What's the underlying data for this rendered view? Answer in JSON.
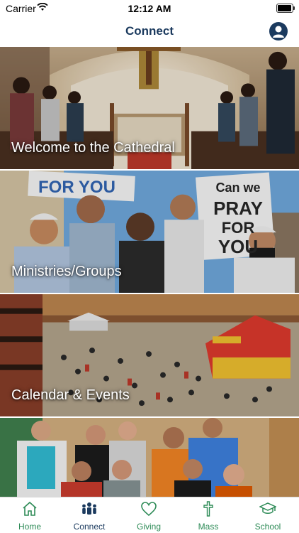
{
  "status_bar": {
    "carrier": "Carrier",
    "time": "12:12 AM"
  },
  "header": {
    "title": "Connect"
  },
  "cards": [
    {
      "label": "Welcome to the Cathedral"
    },
    {
      "label": "Ministries/Groups",
      "sign_left": "FOR YOU",
      "sign_right": "Can we PRAY FOR YOU"
    },
    {
      "label": "Calendar & Events"
    },
    {
      "label": ""
    }
  ],
  "tabs": [
    {
      "label": "Home",
      "icon": "home-icon",
      "active": false
    },
    {
      "label": "Connect",
      "icon": "people-icon",
      "active": true
    },
    {
      "label": "Giving",
      "icon": "heart-icon",
      "active": false
    },
    {
      "label": "Mass",
      "icon": "cross-icon",
      "active": false
    },
    {
      "label": "School",
      "icon": "graduation-cap-icon",
      "active": false
    }
  ],
  "colors": {
    "nav_title": "#1b3a5e",
    "tab_active": "#1b3a5e",
    "tab_inactive": "#2e8b57"
  }
}
